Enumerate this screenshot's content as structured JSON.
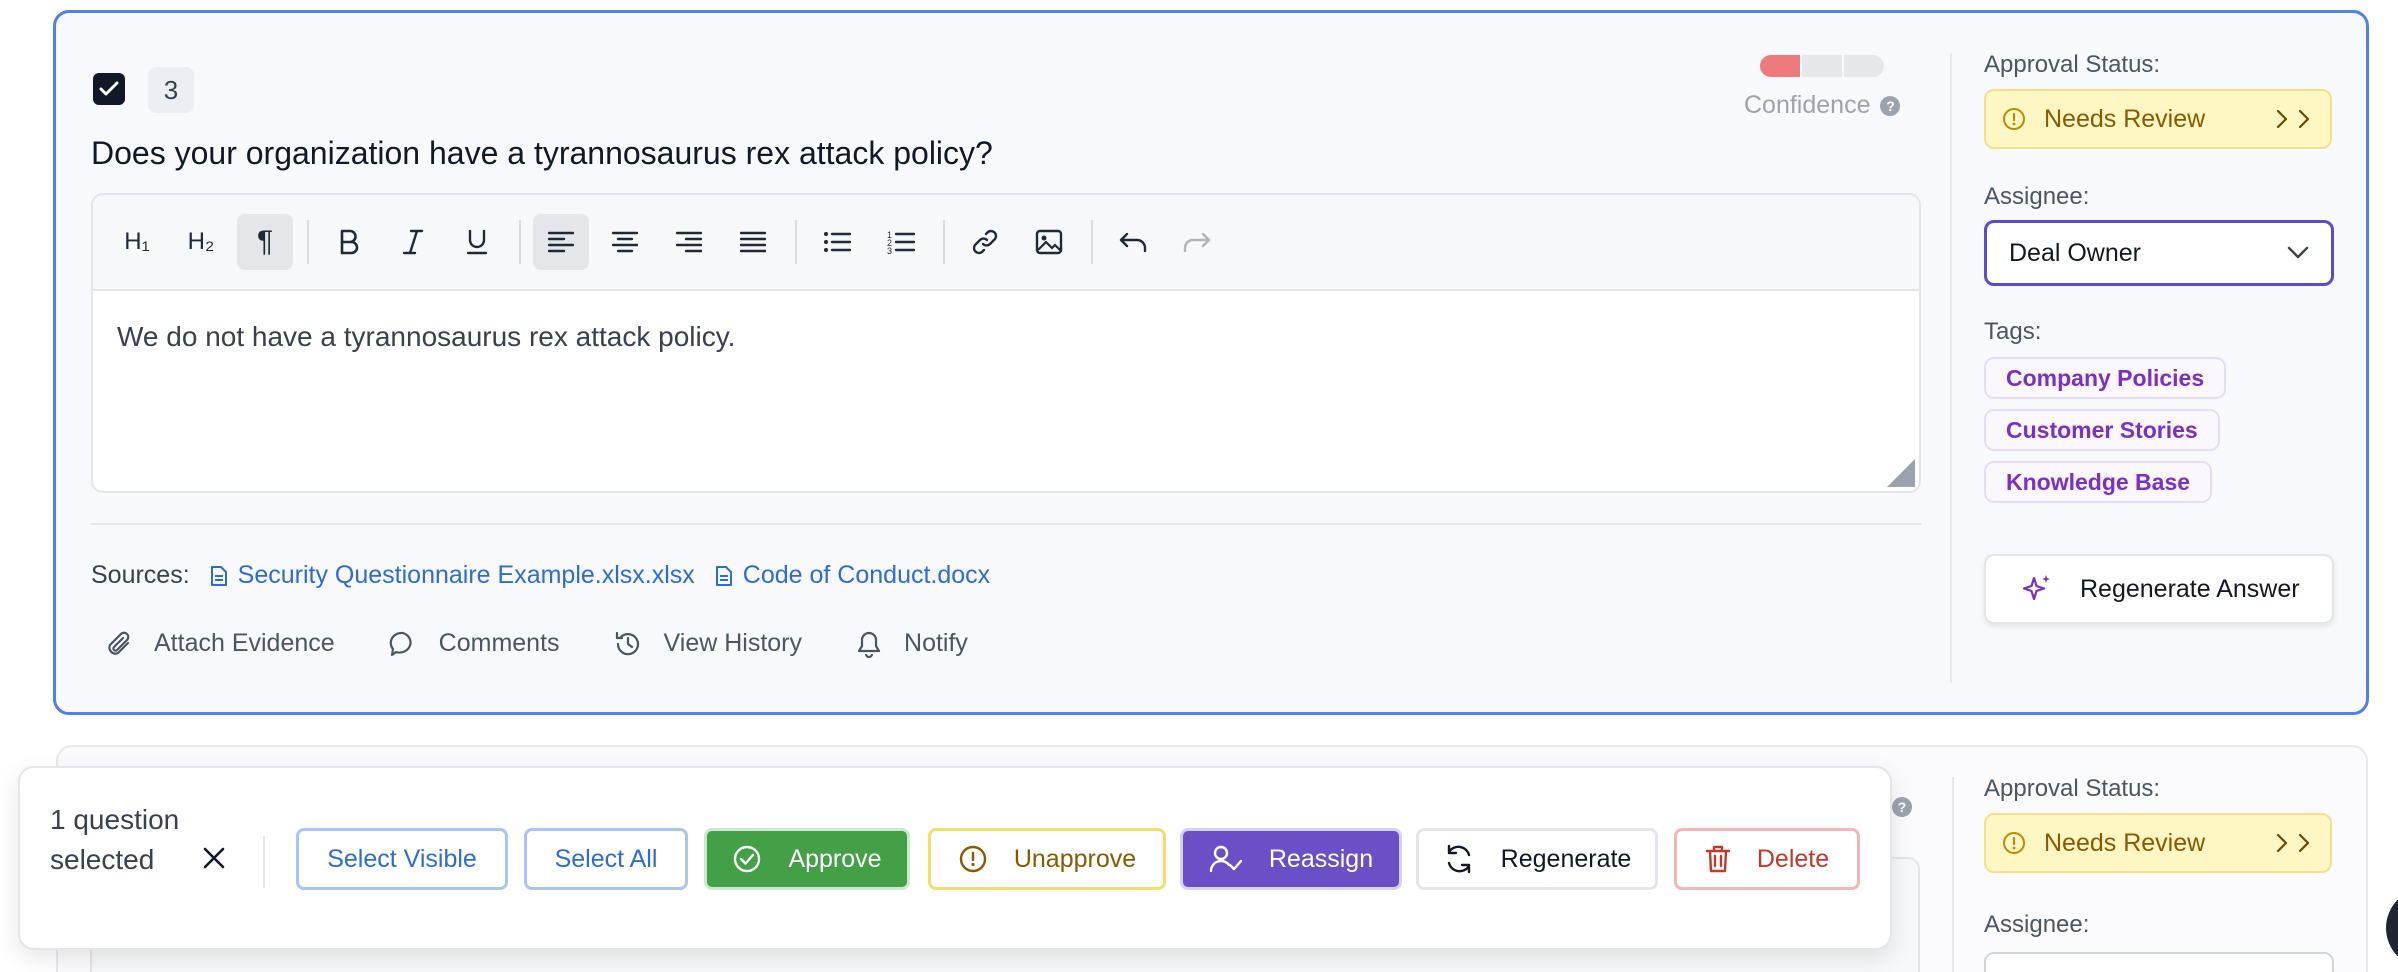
{
  "question": {
    "number": "3",
    "title": "Does your organization have a tyrannosaurus rex attack policy?",
    "confidence_label": "Confidence",
    "confidence_level": 0.33,
    "answer_text": "We do not have a tyrannosaurus rex attack policy.",
    "sources_label": "Sources:",
    "sources": [
      "Security Questionnaire Example.xlsx.xlsx",
      "Code of Conduct.docx"
    ],
    "actions": {
      "attach": "Attach Evidence",
      "comments": "Comments",
      "history": "View History",
      "notify": "Notify"
    }
  },
  "toolbar": {
    "h1": "H₁",
    "h2": "H₂",
    "paragraph": "¶"
  },
  "sidebar": {
    "approval_label": "Approval Status:",
    "approval_value": "Needs Review",
    "assignee_label": "Assignee:",
    "assignee_value": "Deal Owner",
    "tags_label": "Tags:",
    "tags": [
      "Company Policies",
      "Customer Stories",
      "Knowledge Base"
    ],
    "regenerate_label": "Regenerate Answer"
  },
  "second_card": {
    "approval_label": "Approval Status:",
    "approval_value": "Needs Review",
    "assignee_label": "Assignee:"
  },
  "bulk": {
    "count_text": "1 question selected",
    "select_visible": "Select Visible",
    "select_all": "Select All",
    "approve": "Approve",
    "unapprove": "Unapprove",
    "reassign": "Reassign",
    "regenerate": "Regenerate",
    "delete": "Delete"
  },
  "colors": {
    "accent_blue": "#4f7ff0",
    "approve_green": "#43a047",
    "reassign_purple": "#6a4fc7",
    "tag_purple": "#7c2fc7",
    "confidence_red": "#ee7b7b"
  }
}
